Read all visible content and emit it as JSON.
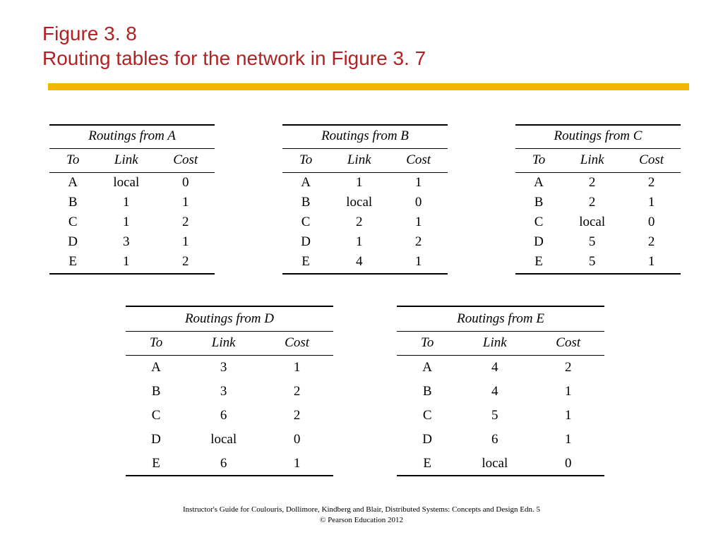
{
  "title_line1": "Figure 3. 8",
  "title_line2": "Routing tables for the network in Figure 3. 7",
  "col_headers": {
    "to": "To",
    "link": "Link",
    "cost": "Cost"
  },
  "tables_top": [
    {
      "caption": "Routings from A",
      "rows": [
        {
          "to": "A",
          "link": "local",
          "cost": "0"
        },
        {
          "to": "B",
          "link": "1",
          "cost": "1"
        },
        {
          "to": "C",
          "link": "1",
          "cost": "2"
        },
        {
          "to": "D",
          "link": "3",
          "cost": "1"
        },
        {
          "to": "E",
          "link": "1",
          "cost": "2"
        }
      ]
    },
    {
      "caption": "Routings from B",
      "rows": [
        {
          "to": "A",
          "link": "1",
          "cost": "1"
        },
        {
          "to": "B",
          "link": "local",
          "cost": "0"
        },
        {
          "to": "C",
          "link": "2",
          "cost": "1"
        },
        {
          "to": "D",
          "link": "1",
          "cost": "2"
        },
        {
          "to": "E",
          "link": "4",
          "cost": "1"
        }
      ]
    },
    {
      "caption": "Routings from C",
      "rows": [
        {
          "to": "A",
          "link": "2",
          "cost": "2"
        },
        {
          "to": "B",
          "link": "2",
          "cost": "1"
        },
        {
          "to": "C",
          "link": "local",
          "cost": "0"
        },
        {
          "to": "D",
          "link": "5",
          "cost": "2"
        },
        {
          "to": "E",
          "link": "5",
          "cost": "1"
        }
      ]
    }
  ],
  "tables_bottom": [
    {
      "caption": "Routings from D",
      "rows": [
        {
          "to": "A",
          "link": "3",
          "cost": "1"
        },
        {
          "to": "B",
          "link": "3",
          "cost": "2"
        },
        {
          "to": "C",
          "link": "6",
          "cost": "2"
        },
        {
          "to": "D",
          "link": "local",
          "cost": "0"
        },
        {
          "to": "E",
          "link": "6",
          "cost": "1"
        }
      ]
    },
    {
      "caption": "Routings from E",
      "rows": [
        {
          "to": "A",
          "link": "4",
          "cost": "2"
        },
        {
          "to": "B",
          "link": "4",
          "cost": "1"
        },
        {
          "to": "C",
          "link": "5",
          "cost": "1"
        },
        {
          "to": "D",
          "link": "6",
          "cost": "1"
        },
        {
          "to": "E",
          "link": "local",
          "cost": "0"
        }
      ]
    }
  ],
  "footer_line1": "Instructor's Guide for  Coulouris, Dollimore, Kindberg and Blair,  Distributed Systems: Concepts and Design   Edn. 5",
  "footer_line2": "©  Pearson Education 2012"
}
